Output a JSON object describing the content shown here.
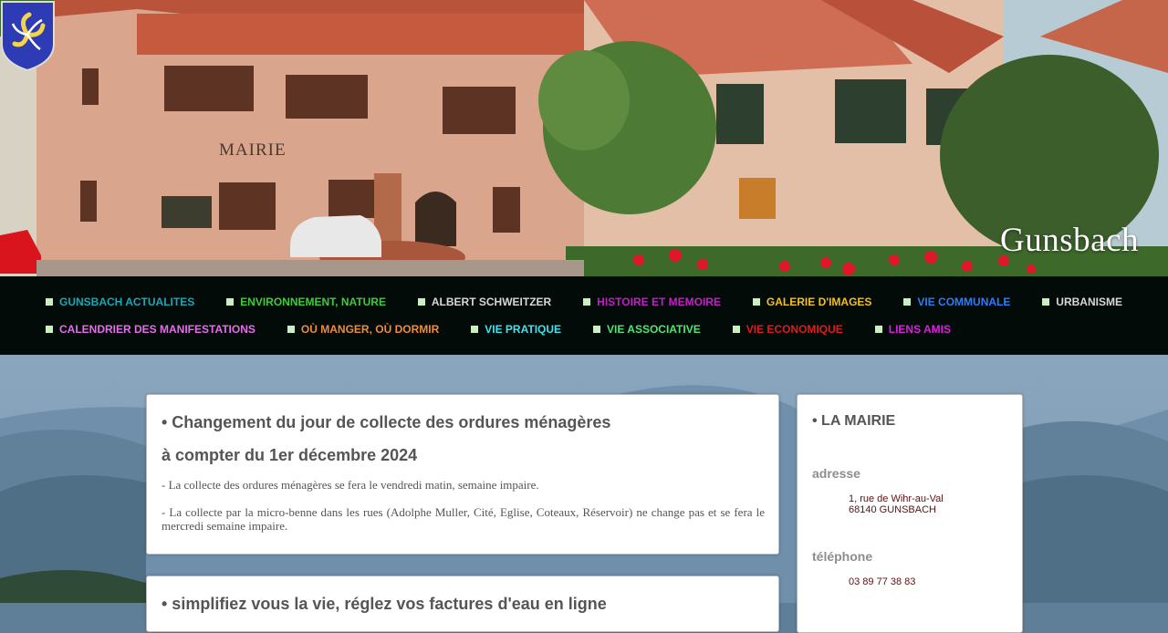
{
  "header": {
    "site_name": "Gunsbach",
    "building_sign": "MAIRIE"
  },
  "nav": {
    "row1": [
      {
        "label": "GUNSBACH ACTUALITES",
        "color": "#1ba7b5"
      },
      {
        "label": "ENVIRONNEMENT, NATURE",
        "color": "#3fca3c"
      },
      {
        "label": "ALBERT SCHWEITZER",
        "color": "#d7d7d7"
      },
      {
        "label": "HISTOIRE ET MEMOIRE",
        "color": "#c31fc4"
      },
      {
        "label": "GALERIE D'IMAGES",
        "color": "#f2c01a"
      },
      {
        "label": "VIE COMMUNALE",
        "color": "#2f7cf5"
      },
      {
        "label": "URBANISME",
        "color": "#d7d7d7"
      }
    ],
    "row2": [
      {
        "label": "CALENDRIER DES MANIFESTATIONS",
        "color": "#e46ee8"
      },
      {
        "label": "OÙ MANGER, OÙ DORMIR",
        "color": "#f08b3a"
      },
      {
        "label": "VIE PRATIQUE",
        "color": "#3fe3ee"
      },
      {
        "label": "VIE ASSOCIATIVE",
        "color": "#52e373"
      },
      {
        "label": "VIE ECONOMIQUE",
        "color": "#e01b1b"
      },
      {
        "label": "LIENS AMIS",
        "color": "#e21be4"
      }
    ]
  },
  "article": {
    "title_line1": "• Changement du jour de collecte des ordures ménagères",
    "title_line2": "à compter du 1er décembre 2024",
    "para1": "- La collecte des ordures ménagères se fera le vendredi matin, semaine impaire.",
    "para2": "- La collecte par la micro-benne dans les rues (Adolphe Muller, Cité, Eglise, Coteaux, Réservoir) ne change pas et se fera le mercredi semaine impaire."
  },
  "article2": {
    "title": "• simplifiez vous la vie, réglez vos factures d'eau en ligne"
  },
  "sidebar": {
    "title": "• LA MAIRIE",
    "address_label": "adresse",
    "address_line1": "1, rue de Wihr-au-Val",
    "address_line2": "68140 GUNSBACH",
    "phone_label": "téléphone",
    "phone": "03 89 77 38 83"
  }
}
